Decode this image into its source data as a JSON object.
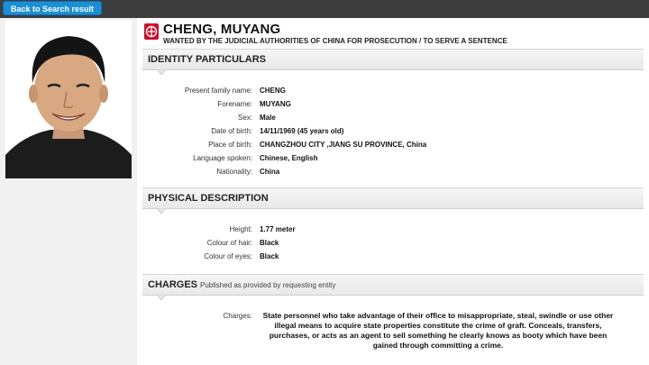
{
  "topbar": {
    "back_label": "Back to Search result"
  },
  "person": {
    "name": "CHENG, MUYANG",
    "subtitle": "WANTED BY THE JUDICIAL AUTHORITIES OF CHINA FOR PROSECUTION / TO SERVE A SENTENCE"
  },
  "identity": {
    "title": "IDENTITY PARTICULARS",
    "rows": [
      {
        "label": "Present family name:",
        "value": "CHENG"
      },
      {
        "label": "Forename:",
        "value": "MUYANG"
      },
      {
        "label": "Sex:",
        "value": "Male"
      },
      {
        "label": "Date of birth:",
        "value": "14/11/1969 (45 years old)"
      },
      {
        "label": "Place of birth:",
        "value": "CHANGZHOU CITY ,JIANG SU PROVINCE, China"
      },
      {
        "label": "Language spoken:",
        "value": "Chinese, English"
      },
      {
        "label": "Nationality:",
        "value": "China"
      }
    ]
  },
  "physical": {
    "title": "PHYSICAL DESCRIPTION",
    "rows": [
      {
        "label": "Height:",
        "value": "1.77 meter"
      },
      {
        "label": "Colour of hair:",
        "value": "Black"
      },
      {
        "label": "Colour of eyes:",
        "value": "Black"
      }
    ]
  },
  "charges": {
    "title": "CHARGES",
    "note": "Published as provided by requesting entity",
    "label": "Charges:",
    "text": "State personnel who take advantage of their office to misappropriate, steal, swindle or use other illegal means to acquire state properties constitute the crime of graft. Conceals, transfers, purchases, or acts as an agent to sell something he clearly knows as booty which have been gained through committing a crime."
  },
  "icons": {
    "notice": "red-notice-icon",
    "photo": "person-photo"
  },
  "colors": {
    "accent": "#1a8fd6",
    "notice_red": "#c8102e",
    "topbar": "#3d3d3d"
  }
}
